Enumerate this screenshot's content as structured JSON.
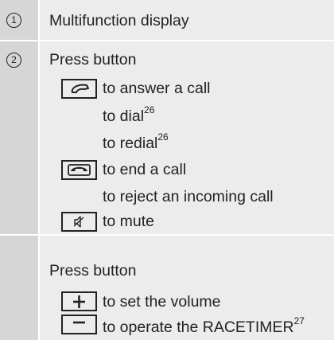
{
  "items": [
    {
      "number": "1",
      "text": "Multifunction display"
    },
    {
      "number": "2",
      "heading": "Press button",
      "lines": [
        {
          "text": "to answer a call",
          "sup": ""
        },
        {
          "text": "to dial",
          "sup": "26"
        },
        {
          "text": "to redial",
          "sup": "26"
        },
        {
          "text": "to end a call",
          "sup": ""
        },
        {
          "text": "to reject an incoming call",
          "sup": ""
        },
        {
          "text": "to mute",
          "sup": ""
        }
      ],
      "buttons": {
        "answer": "phone-pickup-icon",
        "end": "phone-hangup-icon",
        "mute": "speaker-mute-icon"
      }
    },
    {
      "number": "",
      "heading": "Press button",
      "lines": [
        {
          "text": "to set the volume",
          "sup": ""
        },
        {
          "text": "to operate the RACETIMER",
          "sup": "27"
        }
      ],
      "buttons": {
        "plus": "plus-icon",
        "minus": "minus-icon"
      }
    }
  ]
}
